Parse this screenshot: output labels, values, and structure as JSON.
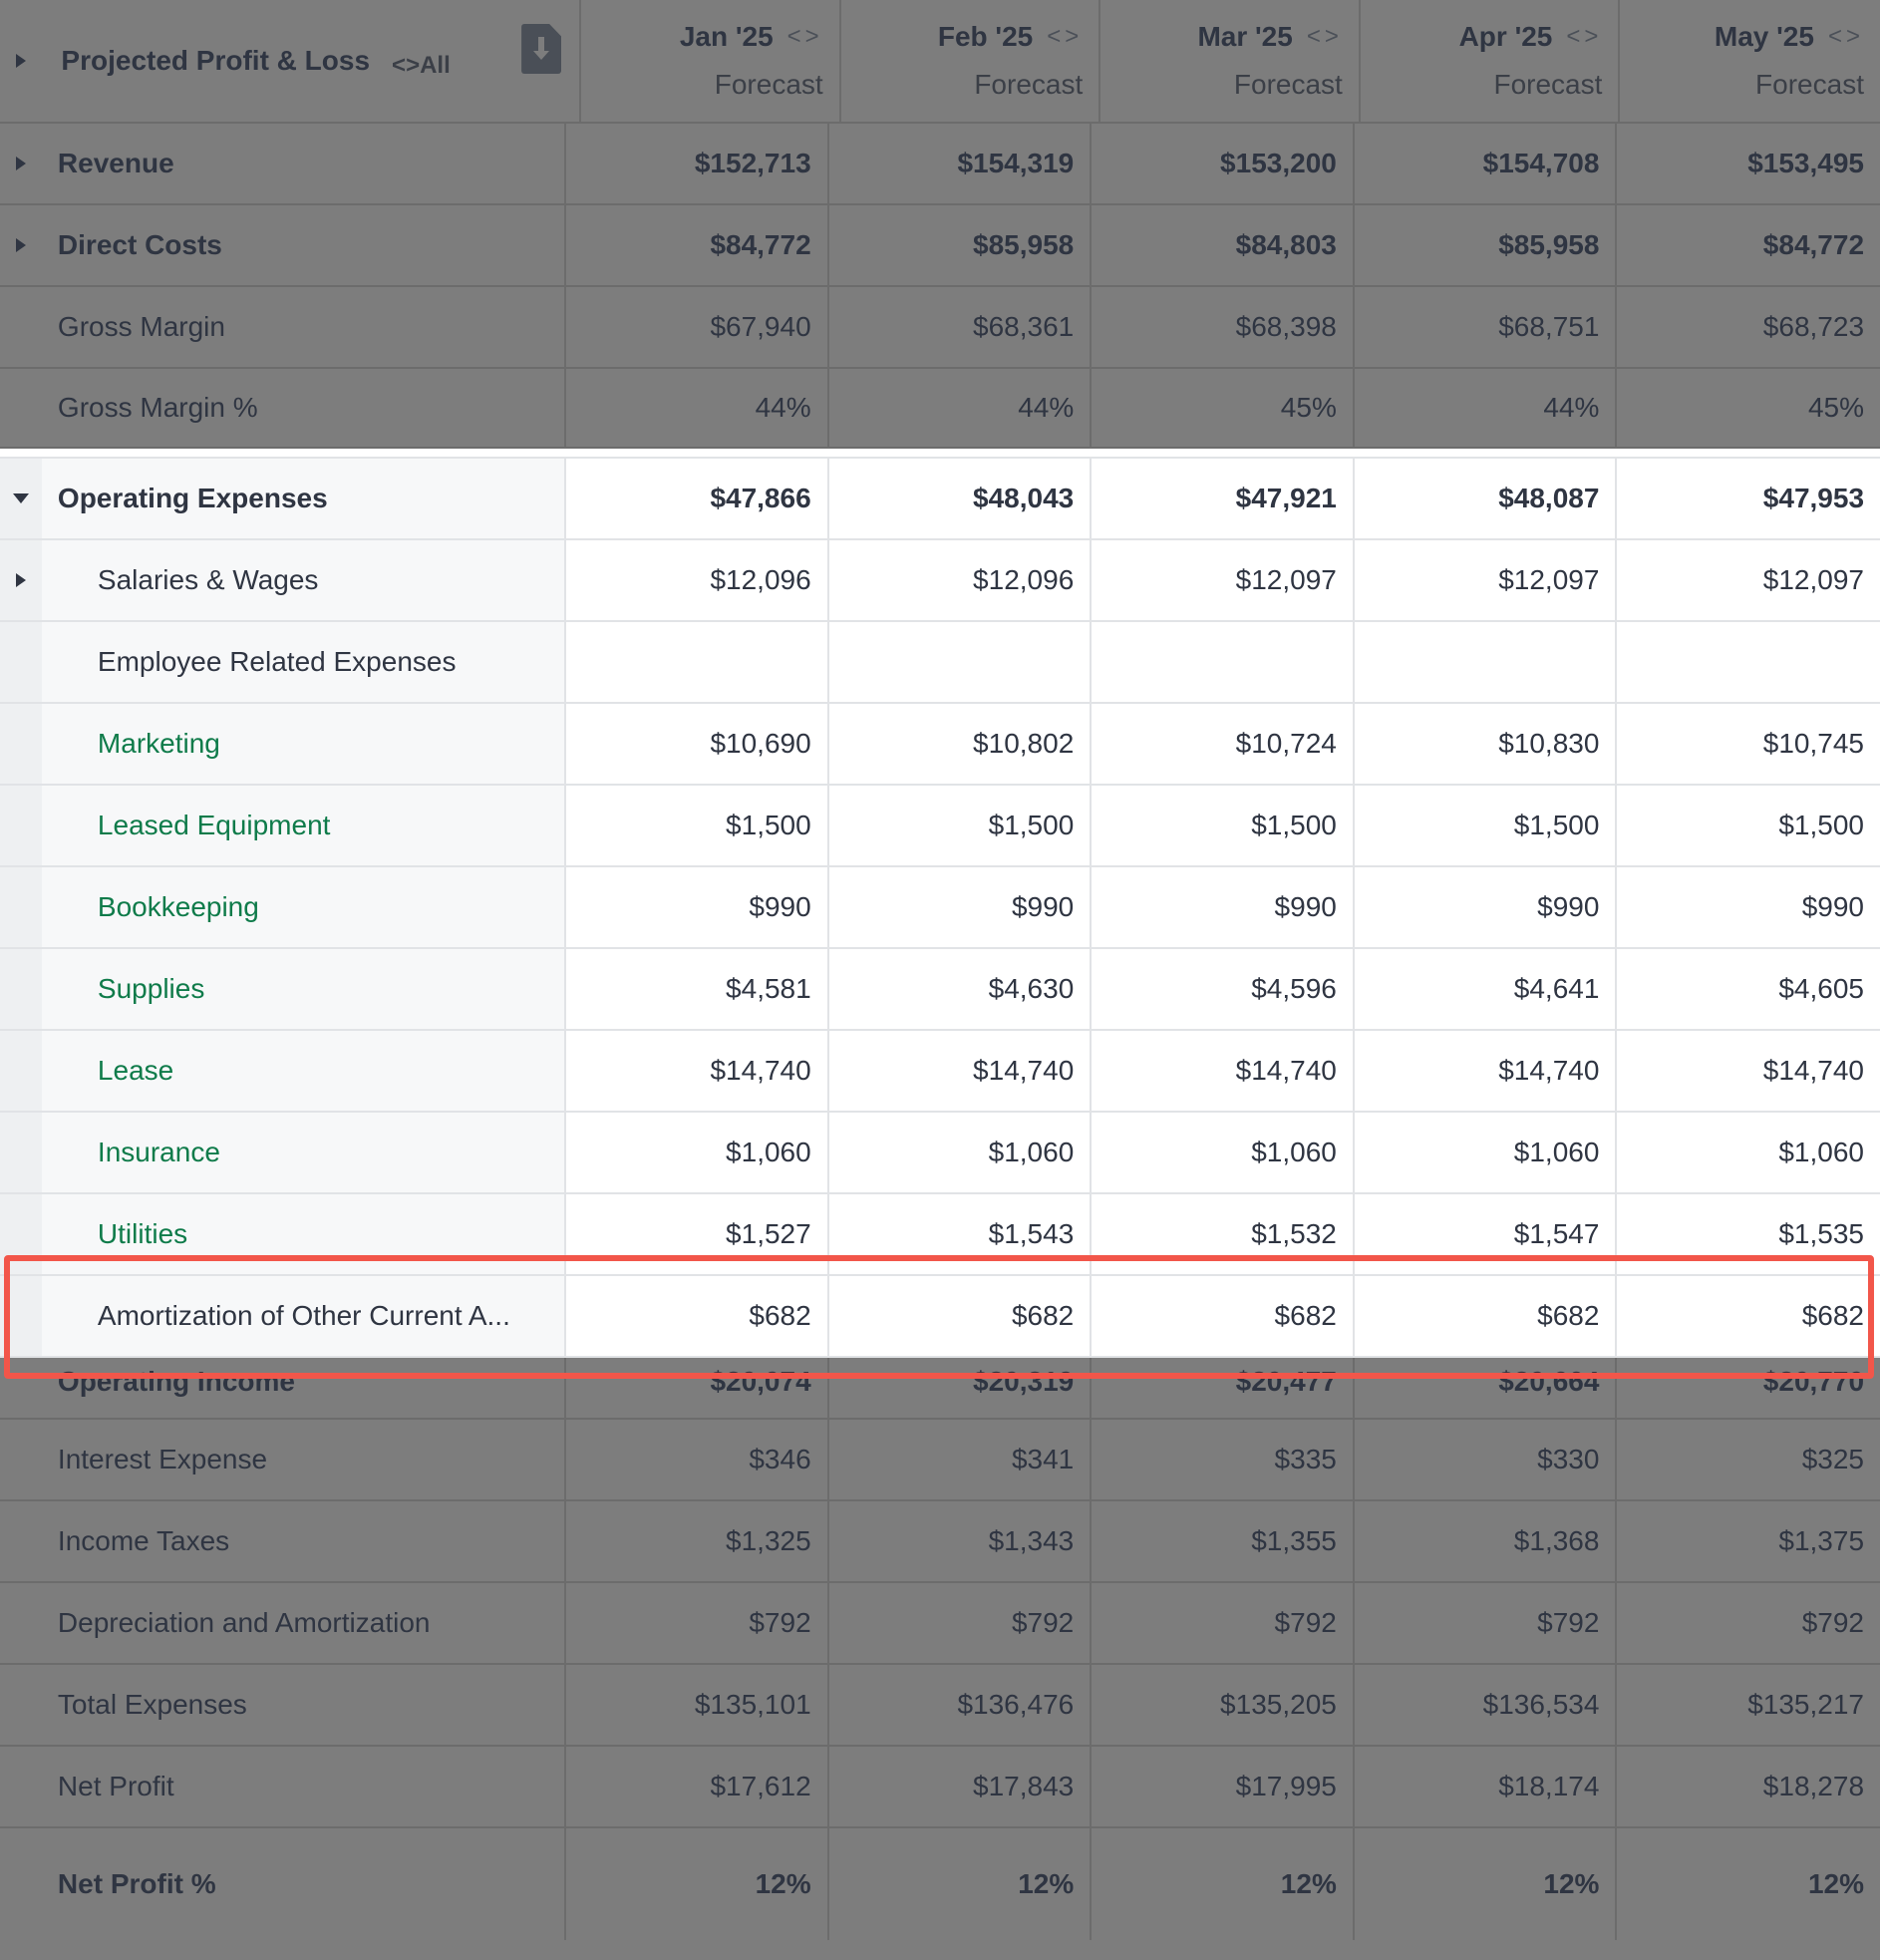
{
  "header": {
    "title": "Projected Profit & Loss",
    "nav_all": "<>All",
    "months": [
      {
        "label": "Jan '25",
        "sub": "Forecast"
      },
      {
        "label": "Feb '25",
        "sub": "Forecast"
      },
      {
        "label": "Mar '25",
        "sub": "Forecast"
      },
      {
        "label": "Apr '25",
        "sub": "Forecast"
      },
      {
        "label": "May '25",
        "sub": "Forecast"
      }
    ],
    "chevrons": "<>"
  },
  "rows": [
    {
      "label": "Revenue",
      "values": [
        "$152,713",
        "$154,319",
        "$153,200",
        "$154,708",
        "$153,495"
      ]
    },
    {
      "label": "Direct Costs",
      "values": [
        "$84,772",
        "$85,958",
        "$84,803",
        "$85,958",
        "$84,772"
      ]
    },
    {
      "label": "Gross Margin",
      "values": [
        "$67,940",
        "$68,361",
        "$68,398",
        "$68,751",
        "$68,723"
      ]
    },
    {
      "label": "Gross Margin %",
      "values": [
        "44%",
        "44%",
        "45%",
        "44%",
        "45%"
      ]
    },
    {
      "label": "Operating Expenses",
      "values": [
        "$47,866",
        "$48,043",
        "$47,921",
        "$48,087",
        "$47,953"
      ]
    },
    {
      "label": "Salaries & Wages",
      "values": [
        "$12,096",
        "$12,096",
        "$12,097",
        "$12,097",
        "$12,097"
      ]
    },
    {
      "label": "Employee Related Expenses",
      "values": [
        "",
        "",
        "",
        "",
        ""
      ]
    },
    {
      "label": "Marketing",
      "values": [
        "$10,690",
        "$10,802",
        "$10,724",
        "$10,830",
        "$10,745"
      ]
    },
    {
      "label": "Leased Equipment",
      "values": [
        "$1,500",
        "$1,500",
        "$1,500",
        "$1,500",
        "$1,500"
      ]
    },
    {
      "label": "Bookkeeping",
      "values": [
        "$990",
        "$990",
        "$990",
        "$990",
        "$990"
      ]
    },
    {
      "label": "Supplies",
      "values": [
        "$4,581",
        "$4,630",
        "$4,596",
        "$4,641",
        "$4,605"
      ]
    },
    {
      "label": "Lease",
      "values": [
        "$14,740",
        "$14,740",
        "$14,740",
        "$14,740",
        "$14,740"
      ]
    },
    {
      "label": "Insurance",
      "values": [
        "$1,060",
        "$1,060",
        "$1,060",
        "$1,060",
        "$1,060"
      ]
    },
    {
      "label": "Utilities",
      "values": [
        "$1,527",
        "$1,543",
        "$1,532",
        "$1,547",
        "$1,535"
      ]
    },
    {
      "label": "Amortization of Other Current A...",
      "values": [
        "$682",
        "$682",
        "$682",
        "$682",
        "$682"
      ]
    },
    {
      "label": "Operating Income",
      "values": [
        "$20,074",
        "$20,319",
        "$20,477",
        "$20,664",
        "$20,770"
      ]
    },
    {
      "label": "Interest Expense",
      "values": [
        "$346",
        "$341",
        "$335",
        "$330",
        "$325"
      ]
    },
    {
      "label": "Income Taxes",
      "values": [
        "$1,325",
        "$1,343",
        "$1,355",
        "$1,368",
        "$1,375"
      ]
    },
    {
      "label": "Depreciation and Amortization",
      "values": [
        "$792",
        "$792",
        "$792",
        "$792",
        "$792"
      ]
    },
    {
      "label": "Total Expenses",
      "values": [
        "$135,101",
        "$136,476",
        "$135,205",
        "$136,534",
        "$135,217"
      ]
    },
    {
      "label": "Net Profit",
      "values": [
        "$17,612",
        "$17,843",
        "$17,995",
        "$18,174",
        "$18,278"
      ]
    },
    {
      "label": "Net Profit %",
      "values": [
        "12%",
        "12%",
        "12%",
        "12%",
        "12%"
      ]
    }
  ],
  "colors": {
    "overlay": "#7d7d7d",
    "link_green": "#0f7b4a",
    "highlight_red": "#f2564a"
  }
}
